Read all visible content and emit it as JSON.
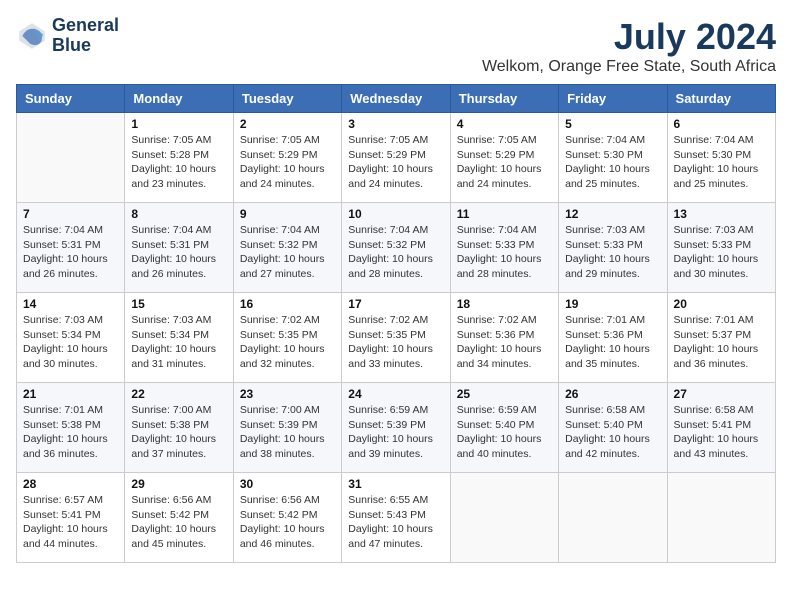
{
  "logo": {
    "line1": "General",
    "line2": "Blue"
  },
  "title": "July 2024",
  "location": "Welkom, Orange Free State, South Africa",
  "weekdays": [
    "Sunday",
    "Monday",
    "Tuesday",
    "Wednesday",
    "Thursday",
    "Friday",
    "Saturday"
  ],
  "weeks": [
    [
      {
        "day": "",
        "sunrise": "",
        "sunset": "",
        "daylight": ""
      },
      {
        "day": "1",
        "sunrise": "Sunrise: 7:05 AM",
        "sunset": "Sunset: 5:28 PM",
        "daylight": "Daylight: 10 hours and 23 minutes."
      },
      {
        "day": "2",
        "sunrise": "Sunrise: 7:05 AM",
        "sunset": "Sunset: 5:29 PM",
        "daylight": "Daylight: 10 hours and 24 minutes."
      },
      {
        "day": "3",
        "sunrise": "Sunrise: 7:05 AM",
        "sunset": "Sunset: 5:29 PM",
        "daylight": "Daylight: 10 hours and 24 minutes."
      },
      {
        "day": "4",
        "sunrise": "Sunrise: 7:05 AM",
        "sunset": "Sunset: 5:29 PM",
        "daylight": "Daylight: 10 hours and 24 minutes."
      },
      {
        "day": "5",
        "sunrise": "Sunrise: 7:04 AM",
        "sunset": "Sunset: 5:30 PM",
        "daylight": "Daylight: 10 hours and 25 minutes."
      },
      {
        "day": "6",
        "sunrise": "Sunrise: 7:04 AM",
        "sunset": "Sunset: 5:30 PM",
        "daylight": "Daylight: 10 hours and 25 minutes."
      }
    ],
    [
      {
        "day": "7",
        "sunrise": "Sunrise: 7:04 AM",
        "sunset": "Sunset: 5:31 PM",
        "daylight": "Daylight: 10 hours and 26 minutes."
      },
      {
        "day": "8",
        "sunrise": "Sunrise: 7:04 AM",
        "sunset": "Sunset: 5:31 PM",
        "daylight": "Daylight: 10 hours and 26 minutes."
      },
      {
        "day": "9",
        "sunrise": "Sunrise: 7:04 AM",
        "sunset": "Sunset: 5:32 PM",
        "daylight": "Daylight: 10 hours and 27 minutes."
      },
      {
        "day": "10",
        "sunrise": "Sunrise: 7:04 AM",
        "sunset": "Sunset: 5:32 PM",
        "daylight": "Daylight: 10 hours and 28 minutes."
      },
      {
        "day": "11",
        "sunrise": "Sunrise: 7:04 AM",
        "sunset": "Sunset: 5:33 PM",
        "daylight": "Daylight: 10 hours and 28 minutes."
      },
      {
        "day": "12",
        "sunrise": "Sunrise: 7:03 AM",
        "sunset": "Sunset: 5:33 PM",
        "daylight": "Daylight: 10 hours and 29 minutes."
      },
      {
        "day": "13",
        "sunrise": "Sunrise: 7:03 AM",
        "sunset": "Sunset: 5:33 PM",
        "daylight": "Daylight: 10 hours and 30 minutes."
      }
    ],
    [
      {
        "day": "14",
        "sunrise": "Sunrise: 7:03 AM",
        "sunset": "Sunset: 5:34 PM",
        "daylight": "Daylight: 10 hours and 30 minutes."
      },
      {
        "day": "15",
        "sunrise": "Sunrise: 7:03 AM",
        "sunset": "Sunset: 5:34 PM",
        "daylight": "Daylight: 10 hours and 31 minutes."
      },
      {
        "day": "16",
        "sunrise": "Sunrise: 7:02 AM",
        "sunset": "Sunset: 5:35 PM",
        "daylight": "Daylight: 10 hours and 32 minutes."
      },
      {
        "day": "17",
        "sunrise": "Sunrise: 7:02 AM",
        "sunset": "Sunset: 5:35 PM",
        "daylight": "Daylight: 10 hours and 33 minutes."
      },
      {
        "day": "18",
        "sunrise": "Sunrise: 7:02 AM",
        "sunset": "Sunset: 5:36 PM",
        "daylight": "Daylight: 10 hours and 34 minutes."
      },
      {
        "day": "19",
        "sunrise": "Sunrise: 7:01 AM",
        "sunset": "Sunset: 5:36 PM",
        "daylight": "Daylight: 10 hours and 35 minutes."
      },
      {
        "day": "20",
        "sunrise": "Sunrise: 7:01 AM",
        "sunset": "Sunset: 5:37 PM",
        "daylight": "Daylight: 10 hours and 36 minutes."
      }
    ],
    [
      {
        "day": "21",
        "sunrise": "Sunrise: 7:01 AM",
        "sunset": "Sunset: 5:38 PM",
        "daylight": "Daylight: 10 hours and 36 minutes."
      },
      {
        "day": "22",
        "sunrise": "Sunrise: 7:00 AM",
        "sunset": "Sunset: 5:38 PM",
        "daylight": "Daylight: 10 hours and 37 minutes."
      },
      {
        "day": "23",
        "sunrise": "Sunrise: 7:00 AM",
        "sunset": "Sunset: 5:39 PM",
        "daylight": "Daylight: 10 hours and 38 minutes."
      },
      {
        "day": "24",
        "sunrise": "Sunrise: 6:59 AM",
        "sunset": "Sunset: 5:39 PM",
        "daylight": "Daylight: 10 hours and 39 minutes."
      },
      {
        "day": "25",
        "sunrise": "Sunrise: 6:59 AM",
        "sunset": "Sunset: 5:40 PM",
        "daylight": "Daylight: 10 hours and 40 minutes."
      },
      {
        "day": "26",
        "sunrise": "Sunrise: 6:58 AM",
        "sunset": "Sunset: 5:40 PM",
        "daylight": "Daylight: 10 hours and 42 minutes."
      },
      {
        "day": "27",
        "sunrise": "Sunrise: 6:58 AM",
        "sunset": "Sunset: 5:41 PM",
        "daylight": "Daylight: 10 hours and 43 minutes."
      }
    ],
    [
      {
        "day": "28",
        "sunrise": "Sunrise: 6:57 AM",
        "sunset": "Sunset: 5:41 PM",
        "daylight": "Daylight: 10 hours and 44 minutes."
      },
      {
        "day": "29",
        "sunrise": "Sunrise: 6:56 AM",
        "sunset": "Sunset: 5:42 PM",
        "daylight": "Daylight: 10 hours and 45 minutes."
      },
      {
        "day": "30",
        "sunrise": "Sunrise: 6:56 AM",
        "sunset": "Sunset: 5:42 PM",
        "daylight": "Daylight: 10 hours and 46 minutes."
      },
      {
        "day": "31",
        "sunrise": "Sunrise: 6:55 AM",
        "sunset": "Sunset: 5:43 PM",
        "daylight": "Daylight: 10 hours and 47 minutes."
      },
      {
        "day": "",
        "sunrise": "",
        "sunset": "",
        "daylight": ""
      },
      {
        "day": "",
        "sunrise": "",
        "sunset": "",
        "daylight": ""
      },
      {
        "day": "",
        "sunrise": "",
        "sunset": "",
        "daylight": ""
      }
    ]
  ]
}
